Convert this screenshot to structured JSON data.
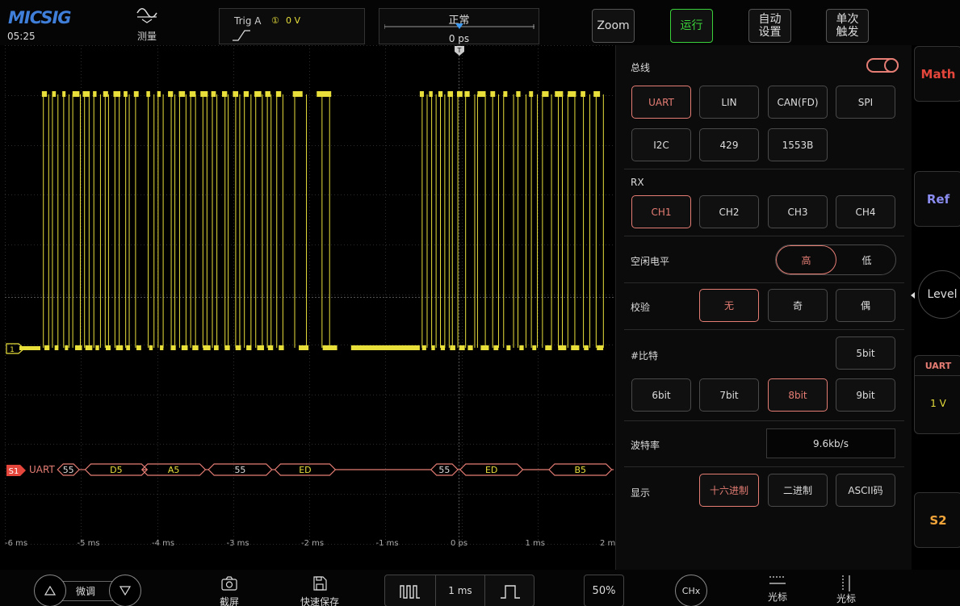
{
  "header": {
    "brand": "MICSIG",
    "clock": "05:25",
    "measure_label": "测量",
    "trigger": {
      "source_label": "Trig A",
      "channel_glyph": "①",
      "level": "0 V"
    },
    "timebase": {
      "mode": "正常",
      "position": "0 ps"
    },
    "buttons": {
      "zoom": "Zoom",
      "run": "运行",
      "auto_set_1": "自动",
      "auto_set_2": "设置",
      "single_1": "单次",
      "single_2": "触发"
    }
  },
  "waveform": {
    "trigger_marker": "T",
    "channel_marker": "1",
    "bus_marker": "S1",
    "bus_label": "UART",
    "time_ticks": [
      "-6 ms",
      "-5 ms",
      "-4 ms",
      "-3 ms",
      "-2 ms",
      "-1 ms",
      "0 ps",
      "1 ms",
      "2 m"
    ],
    "decoded_frames": [
      {
        "label": "55",
        "x0": -5.37,
        "x1": -5.08
      },
      {
        "label": "D5",
        "x0": -5.0,
        "x1": -4.17
      },
      {
        "label": "A5",
        "x0": -4.24,
        "x1": -3.39
      },
      {
        "label": "55",
        "x0": -3.35,
        "x1": -2.5
      },
      {
        "label": "ED",
        "x0": -2.46,
        "x1": -1.65
      },
      {
        "label": "55",
        "x0": -0.37,
        "x1": -0.01
      },
      {
        "label": "ED",
        "x0": 0.02,
        "x1": 0.86
      },
      {
        "label": "B5",
        "x0": 1.21,
        "x1": 2.05
      }
    ]
  },
  "panel": {
    "bus_title": "总线",
    "protocols": [
      "UART",
      "LIN",
      "CAN(FD)",
      "SPI",
      "I2C",
      "429",
      "1553B"
    ],
    "selected_protocol": "UART",
    "rx_title": "RX",
    "channels": [
      "CH1",
      "CH2",
      "CH3",
      "CH4"
    ],
    "selected_channel": "CH1",
    "idle_title": "空闲电平",
    "idle_options": [
      "高",
      "低"
    ],
    "parity_title": "校验",
    "parity_options": [
      "无",
      "奇",
      "偶"
    ],
    "bits_title": "#比特",
    "bit_options": [
      "5bit",
      "6bit",
      "7bit",
      "8bit",
      "9bit"
    ],
    "selected_bits": "8bit",
    "baud_title": "波特率",
    "baud_value": "9.6kb/s",
    "display_title": "显示",
    "display_options": [
      "十六进制",
      "二进制",
      "ASCII码"
    ],
    "selected_display": "十六进制"
  },
  "rail": {
    "math": "Math",
    "ref": "Ref",
    "level": "Level",
    "bus_name": "UART",
    "bus_level": "1 V",
    "s2": "S2"
  },
  "bottom": {
    "fine_tune": "微调",
    "screenshot": "截屏",
    "quick_save": "快速保存",
    "timebase": "1 ms",
    "percent": "50%",
    "chx": "CHx",
    "cursor_h": "光标",
    "cursor_v": "光标"
  },
  "colors": {
    "ch1": "#e8df3b",
    "accent": "#e57d74",
    "run": "#3ad13a",
    "brand": "#3f7fd9",
    "math": "#e5463b",
    "ref": "#8a8cf0",
    "s2": "#f0a43a"
  }
}
